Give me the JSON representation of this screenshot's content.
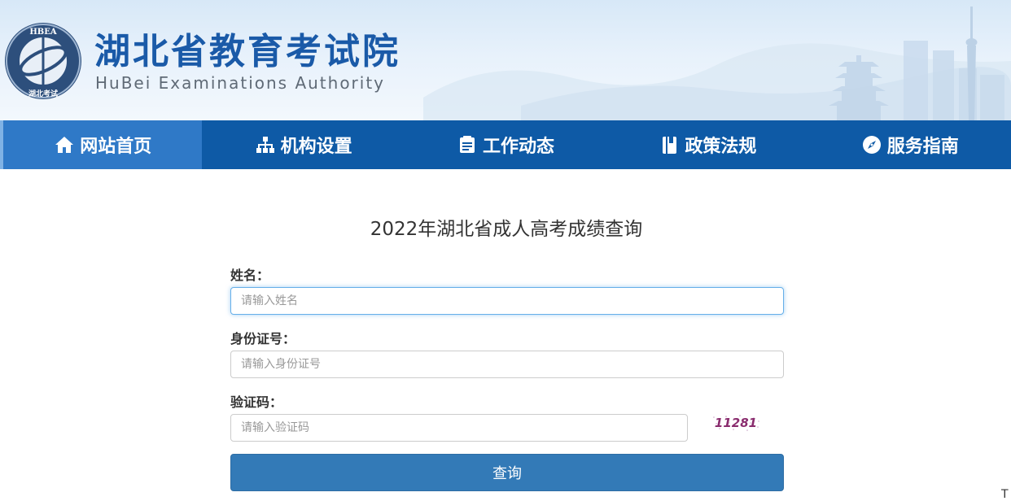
{
  "header": {
    "title": "湖北省教育考试院",
    "subtitle": "HuBei Examinations Authority",
    "logo_ring_text": "HBEA",
    "logo_inner_text": "湖北考试"
  },
  "nav": {
    "items": [
      {
        "label": "网站首页",
        "icon": "home-icon",
        "active": true
      },
      {
        "label": "机构设置",
        "icon": "org-chart-icon",
        "active": false
      },
      {
        "label": "工作动态",
        "icon": "news-icon",
        "active": false
      },
      {
        "label": "政策法规",
        "icon": "book-icon",
        "active": false
      },
      {
        "label": "服务指南",
        "icon": "compass-icon",
        "active": false
      }
    ]
  },
  "form": {
    "heading": "2022年湖北省成人高考成绩查询",
    "name": {
      "label": "姓名：",
      "placeholder": "请输入姓名",
      "value": ""
    },
    "id_number": {
      "label": "身份证号：",
      "placeholder": "请输入身份证号",
      "value": ""
    },
    "captcha": {
      "label": "验证码：",
      "placeholder": "请输入验证码",
      "value": "",
      "image_text": "11281"
    },
    "submit_label": "查询"
  },
  "edge_fragment": "T",
  "colors": {
    "nav_bg": "#0e5aa6",
    "nav_active": "#2f79c7",
    "title_blue": "#1a5aa8",
    "button_bg": "#337ab7",
    "focus_border": "#66afe9"
  }
}
